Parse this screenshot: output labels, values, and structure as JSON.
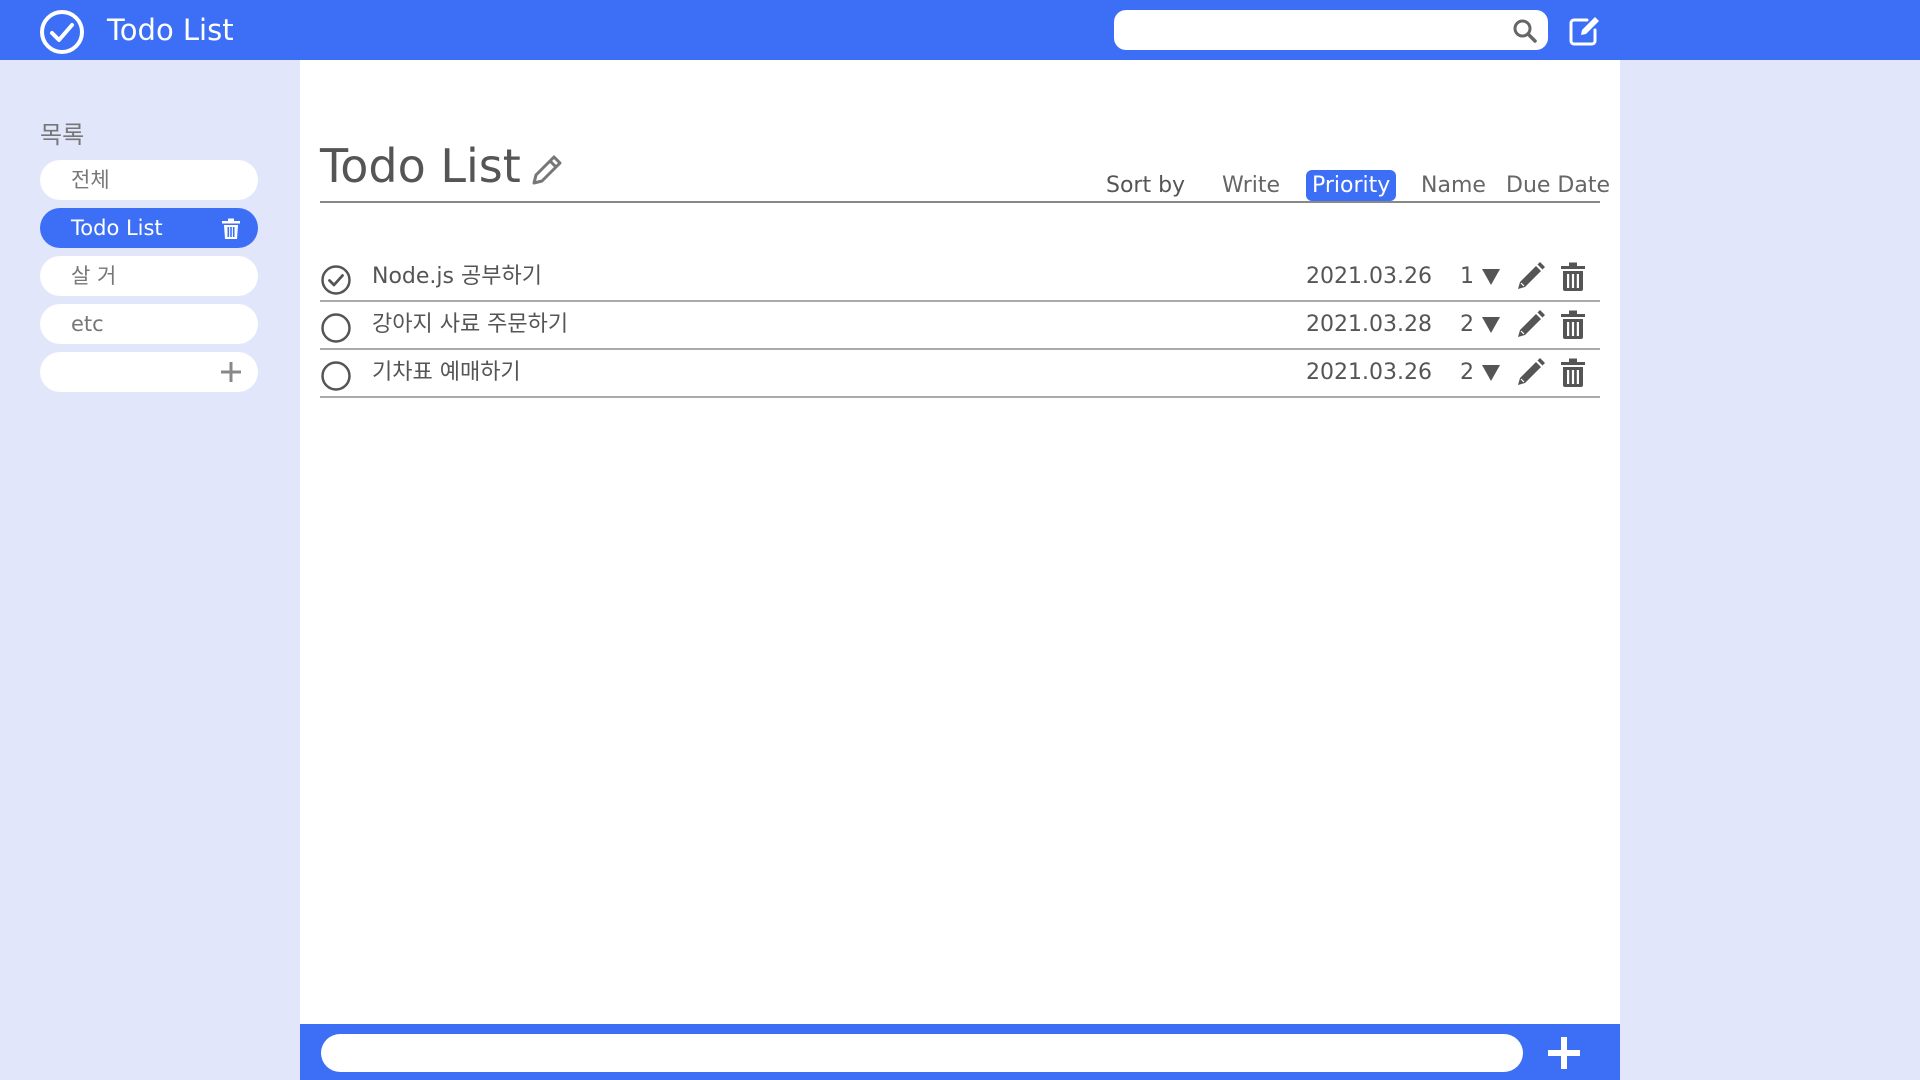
{
  "header": {
    "title": "Todo List",
    "search_placeholder": "",
    "search_icon": "search-icon",
    "compose_icon": "compose-icon",
    "accent_color": "#3c6ff5"
  },
  "sidebar": {
    "title": "목록",
    "items": [
      {
        "label": "전체",
        "active": false
      },
      {
        "label": "Todo List",
        "active": true,
        "icon": "trash-icon"
      },
      {
        "label": "살 거",
        "active": false
      },
      {
        "label": "etc",
        "active": false
      }
    ],
    "add_icon": "plus-icon"
  },
  "main": {
    "title": "Todo List",
    "title_icon": "pencil-icon",
    "sort": {
      "label": "Sort by",
      "options": [
        "Write",
        "Priority",
        "Name",
        "Due Date"
      ],
      "selected": "Priority"
    },
    "todos": [
      {
        "text": "Node.js 공부하기",
        "date": "2021.03.26",
        "priority": "1",
        "done": true
      },
      {
        "text": "강아지 사료 주문하기",
        "date": "2021.03.28",
        "priority": "2",
        "done": false
      },
      {
        "text": "기차표 예매하기",
        "date": "2021.03.26",
        "priority": "2",
        "done": false
      }
    ]
  },
  "footer": {
    "input_placeholder": "",
    "add_icon": "plus-icon"
  }
}
